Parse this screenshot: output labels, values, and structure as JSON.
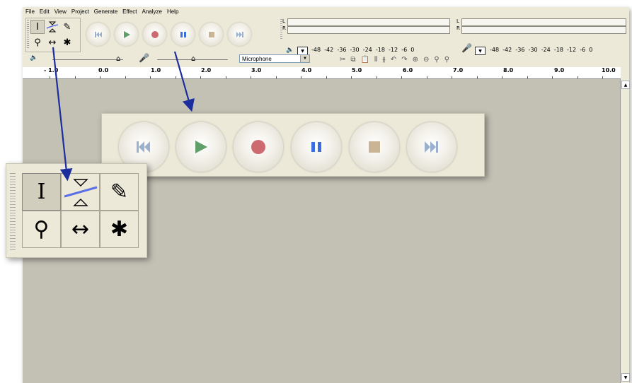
{
  "menu": [
    "File",
    "Edit",
    "View",
    "Project",
    "Generate",
    "Effect",
    "Analyze",
    "Help"
  ],
  "tools": {
    "selection_glyph": "I",
    "draw_glyph": "✎",
    "zoom_glyph": "⚲",
    "timeshift_glyph": "↔",
    "multi_glyph": "✱",
    "selected": "selection"
  },
  "transport": [
    "skip-to-start",
    "play",
    "record",
    "pause",
    "stop",
    "skip-to-end"
  ],
  "meters": {
    "left_label": "L",
    "right_label": "R",
    "scale": [
      "-48",
      "-42",
      "-36",
      "-30",
      "-24",
      "-18",
      "-12",
      "-6",
      "0"
    ]
  },
  "mixer": {
    "input_source": "Microphone"
  },
  "ruler": {
    "labels": [
      "- 1.0",
      "0.0",
      "1.0",
      "2.0",
      "3.0",
      "4.0",
      "5.0",
      "6.0",
      "7.0",
      "8.0",
      "9.0",
      "10.0"
    ]
  },
  "colors": {
    "play": "#5f9f6a",
    "record": "#cc6a70",
    "pause": "#3a6ee0",
    "stop": "#c9b596",
    "skip": "#9bb0cc",
    "arrow": "#1c2d9e"
  }
}
